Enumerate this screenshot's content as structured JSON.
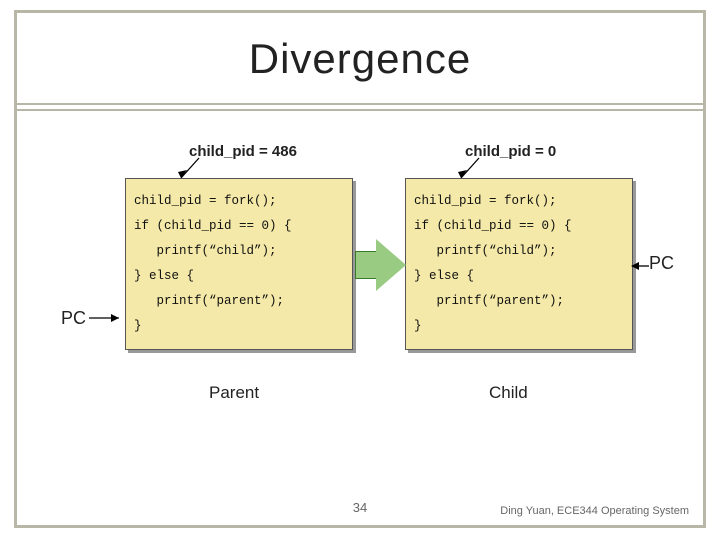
{
  "title": "Divergence",
  "var_labels": {
    "left": "child_pid = 486",
    "right": "child_pid = 0"
  },
  "code": {
    "line1": "child_pid = fork();",
    "line2": "if (child_pid == 0) {",
    "line3": "   printf(“child”);",
    "line4": "} else {",
    "line5": "   printf(“parent”);",
    "line6": "}"
  },
  "pc_label": "PC",
  "captions": {
    "left": "Parent",
    "right": "Child"
  },
  "page_number": "34",
  "footer": "Ding Yuan, ECE344 Operating System"
}
